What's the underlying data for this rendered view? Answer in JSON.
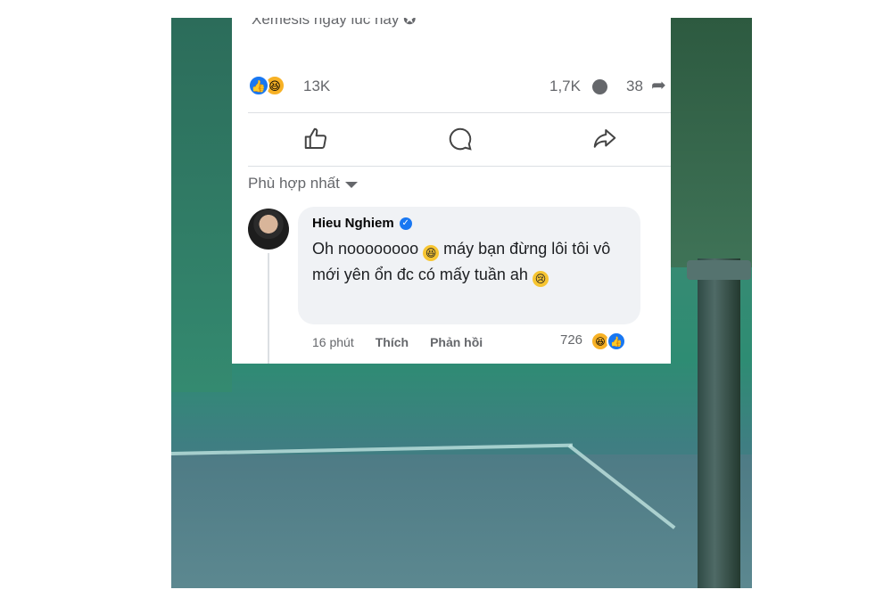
{
  "post": {
    "caption": "Xemesis ngay lúc nãy",
    "reaction_count": "13K",
    "comments_count": "1,7K",
    "shares_count": "38",
    "reaction_icons": [
      "like-icon",
      "haha-icon"
    ]
  },
  "actions": {
    "like_icon": "thumbs-up-icon",
    "comment_icon": "comment-icon",
    "share_icon": "share-icon"
  },
  "sort": {
    "label": "Phù hợp nhất"
  },
  "comment": {
    "author": "Hieu Nghiem",
    "text_part1": "Oh noooooooo",
    "text_part2": " máy bạn đừng lôi tôi vô mới yên ổn đc có mấy tuần ah",
    "time": "16 phút",
    "like_label": "Thích",
    "reply_label": "Phản hồi",
    "reaction_count": "726"
  },
  "colors": {
    "facebook_blue": "#1877f2",
    "haha_yellow": "#f7b125",
    "secondary_text": "#65676b",
    "bubble_bg": "#f0f2f5"
  }
}
